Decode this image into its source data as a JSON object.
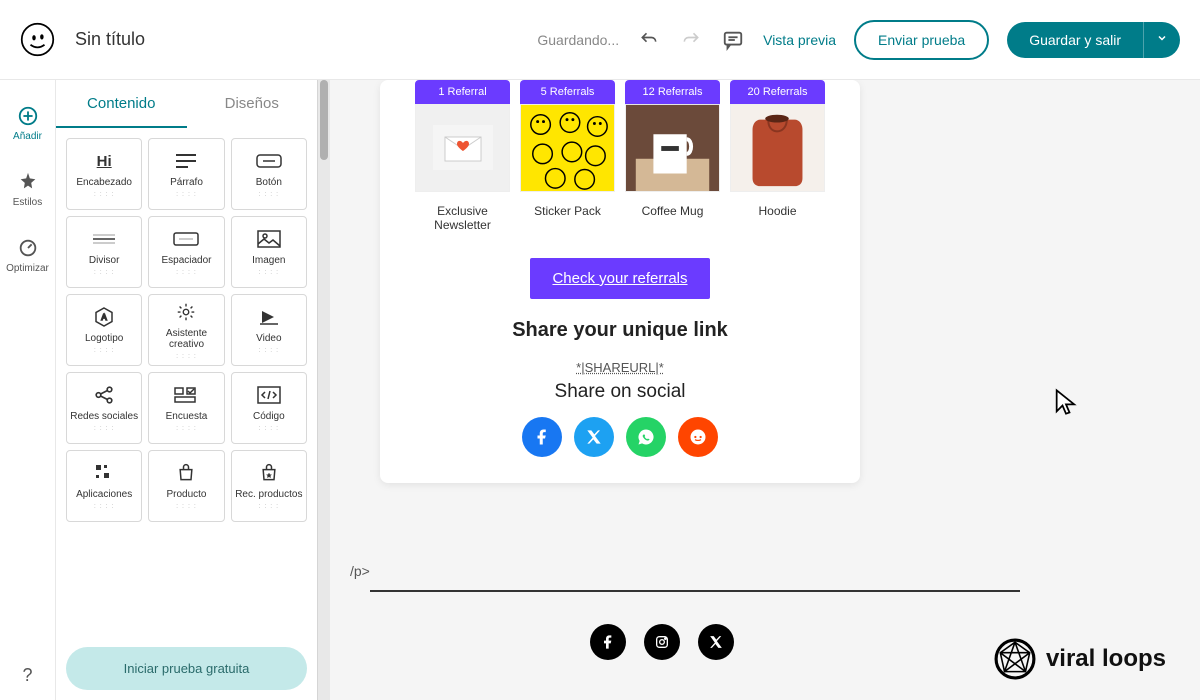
{
  "header": {
    "title": "Sin título",
    "saving": "Guardando...",
    "preview": "Vista previa",
    "send_test": "Enviar prueba",
    "save_exit": "Guardar y salir"
  },
  "rail": {
    "add": "Añadir",
    "styles": "Estilos",
    "optimize": "Optimizar"
  },
  "panel": {
    "tabs": {
      "content": "Contenido",
      "layouts": "Diseños"
    },
    "blocks": [
      {
        "id": "heading",
        "label": "Encabezado"
      },
      {
        "id": "paragraph",
        "label": "Párrafo"
      },
      {
        "id": "button",
        "label": "Botón"
      },
      {
        "id": "divider",
        "label": "Divisor"
      },
      {
        "id": "spacer",
        "label": "Espaciador"
      },
      {
        "id": "image",
        "label": "Imagen"
      },
      {
        "id": "logo",
        "label": "Logotipo"
      },
      {
        "id": "assistant",
        "label": "Asistente creativo"
      },
      {
        "id": "video",
        "label": "Video"
      },
      {
        "id": "social",
        "label": "Redes sociales"
      },
      {
        "id": "survey",
        "label": "Encuesta"
      },
      {
        "id": "code",
        "label": "Código"
      },
      {
        "id": "apps",
        "label": "Aplicaciones"
      },
      {
        "id": "product",
        "label": "Producto"
      },
      {
        "id": "product-rec",
        "label": "Rec. productos"
      }
    ],
    "trial": "Iniciar prueba gratuita"
  },
  "email": {
    "rewards": [
      {
        "header": "1 Referral",
        "label": "Exclusive Newsletter"
      },
      {
        "header": "5 Referrals",
        "label": "Sticker Pack"
      },
      {
        "header": "12 Referrals",
        "label": "Coffee Mug"
      },
      {
        "header": "20 Referrals",
        "label": "Hoodie"
      }
    ],
    "cta": "Check your referrals",
    "share_heading": "Share your unique link",
    "share_url": "*|SHAREURL|*",
    "share_sub": "Share on social",
    "stray": "/p>"
  },
  "watermark": "viral loops"
}
